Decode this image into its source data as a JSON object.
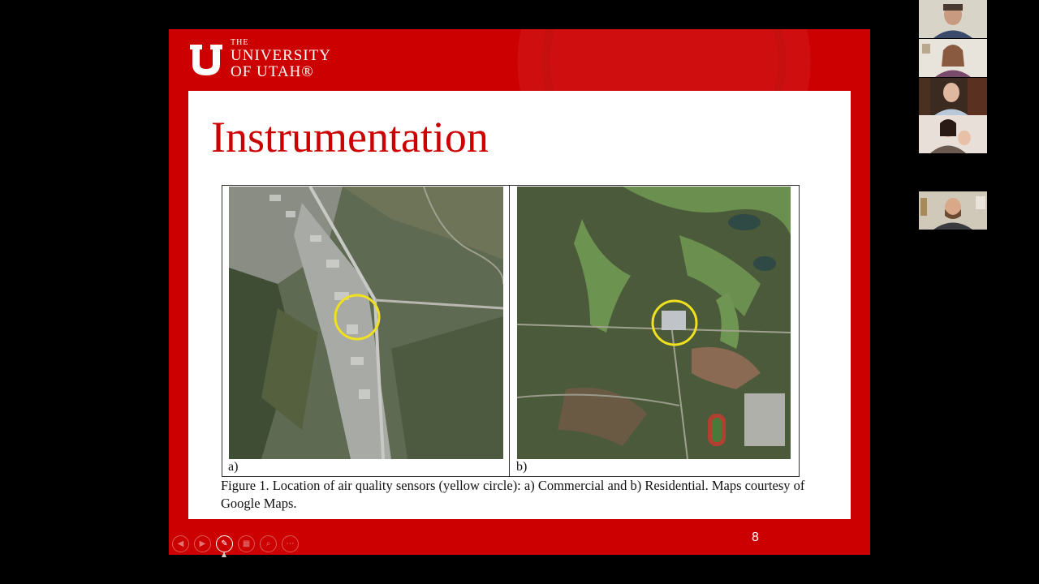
{
  "slide": {
    "logo": {
      "line1": "THE",
      "line2": "UNIVERSITY",
      "line3": "OF UTAH®"
    },
    "title": "Instrumentation",
    "figure": {
      "label_a": "a)",
      "label_b": "b)",
      "caption": "Figure 1. Location of air quality sensors (yellow circle): a) Commercial and b) Residential. Maps courtesy of Google Maps."
    },
    "page_number": "8"
  },
  "controls": [
    {
      "name": "previous-slide-icon",
      "glyph": "◀"
    },
    {
      "name": "next-slide-icon",
      "glyph": "▶"
    },
    {
      "name": "pen-icon",
      "glyph": "✎"
    },
    {
      "name": "slides-grid-icon",
      "glyph": "▦"
    },
    {
      "name": "zoom-icon",
      "glyph": "⌕"
    },
    {
      "name": "more-options-icon",
      "glyph": "⋯"
    }
  ],
  "participants": [
    {
      "id": "participant-1"
    },
    {
      "id": "participant-2"
    },
    {
      "id": "participant-3"
    },
    {
      "id": "participant-4"
    },
    {
      "id": "participant-5"
    }
  ],
  "colors": {
    "brand_red": "#cc0000",
    "marker_yellow": "#f0e020"
  }
}
